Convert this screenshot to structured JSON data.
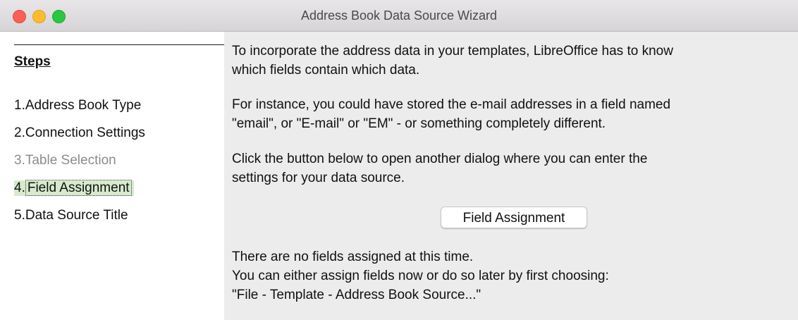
{
  "window": {
    "title": "Address Book Data Source Wizard"
  },
  "sidebar": {
    "heading": "Steps",
    "steps": [
      {
        "num": "1.",
        "label": "Address Book Type",
        "state": "enabled"
      },
      {
        "num": "2.",
        "label": "Connection Settings",
        "state": "enabled"
      },
      {
        "num": "3.",
        "label": "Table Selection",
        "state": "disabled"
      },
      {
        "num": "4.",
        "label": "Field Assignment",
        "state": "current"
      },
      {
        "num": "5.",
        "label": "Data Source Title",
        "state": "enabled"
      }
    ]
  },
  "main": {
    "intro_line1": "To incorporate the address data in your templates, LibreOffice has to know",
    "intro_line2": "which fields contain which data.",
    "example_line1": "For instance, you could have stored the e-mail addresses in a field named",
    "example_line2": "\"email\", or \"E-mail\" or \"EM\" - or something completely different.",
    "instruction_line1": "Click the button below to open another dialog where you can enter the",
    "instruction_line2": "settings for your data source.",
    "field_assignment_button": "Field Assignment",
    "status_line1": "There are no fields assigned at this time.",
    "status_line2": "You can either assign fields now or do so later by first choosing:",
    "status_line3": "\"File - Template - Address Book Source...\""
  },
  "colors": {
    "current_step_highlight": "#d6ebcc",
    "close_button": "#fc5f57",
    "minimize_button": "#fdbc2e",
    "maximize_button": "#28c840"
  }
}
